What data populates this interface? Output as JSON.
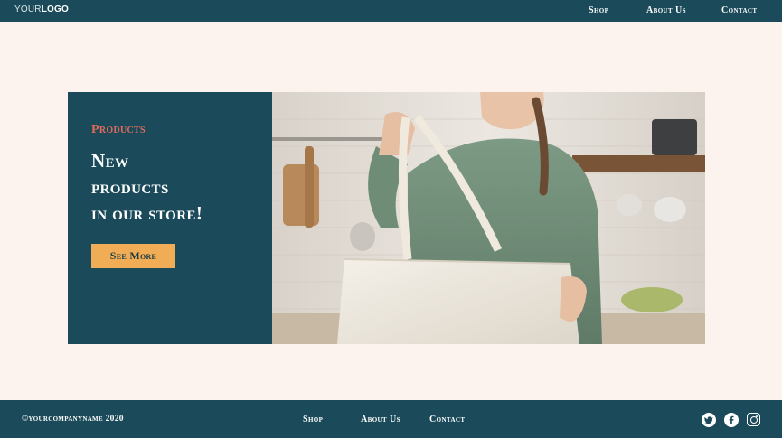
{
  "header": {
    "logo_light": "YOUR",
    "logo_bold": "LOGO",
    "nav": [
      "Shop",
      "About Us",
      "Contact"
    ]
  },
  "hero": {
    "eyebrow": "Products",
    "headline_lines": [
      "New",
      "products",
      "in our store!"
    ],
    "button_label": "See More",
    "image": "woman-holding-tote-bag-photo"
  },
  "footer": {
    "copyright": "©yourcompanyname 2020",
    "nav": [
      "Shop",
      "About Us",
      "Contact"
    ],
    "social_icons": [
      "twitter-icon",
      "facebook-icon",
      "instagram-icon"
    ]
  },
  "colors": {
    "primary": "#1b4b5a",
    "background": "#fdf3ee",
    "accent": "#f0ad55",
    "eyebrow": "#e06b5c"
  }
}
